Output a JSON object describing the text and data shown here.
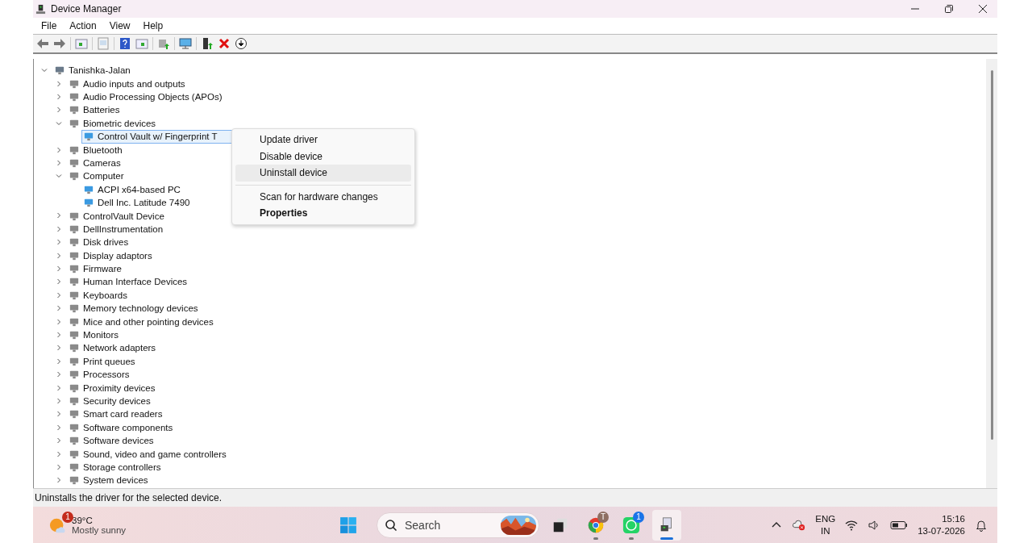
{
  "window": {
    "title": "Device Manager"
  },
  "menu": [
    "File",
    "Action",
    "View",
    "Help"
  ],
  "tree": {
    "label": "Tanishka-Jalan",
    "expanded": true,
    "selected": false,
    "children": [
      {
        "label": "Audio inputs and outputs",
        "expanded": false,
        "selected": false
      },
      {
        "label": "Audio Processing Objects (APOs)",
        "expanded": false,
        "selected": false
      },
      {
        "label": "Batteries",
        "expanded": false,
        "selected": false
      },
      {
        "label": "Biometric devices",
        "expanded": true,
        "selected": false,
        "children": [
          {
            "label": "Control Vault w/ Fingerprint T",
            "selected": true
          }
        ]
      },
      {
        "label": "Bluetooth",
        "expanded": false,
        "selected": false
      },
      {
        "label": "Cameras",
        "expanded": false,
        "selected": false
      },
      {
        "label": "Computer",
        "expanded": true,
        "selected": false,
        "children": [
          {
            "label": "ACPI x64-based PC",
            "selected": false
          },
          {
            "label": "Dell Inc. Latitude 7490",
            "selected": false
          }
        ]
      },
      {
        "label": "ControlVault Device",
        "expanded": false,
        "selected": false
      },
      {
        "label": "DellInstrumentation",
        "expanded": false,
        "selected": false
      },
      {
        "label": "Disk drives",
        "expanded": false,
        "selected": false
      },
      {
        "label": "Display adaptors",
        "expanded": false,
        "selected": false
      },
      {
        "label": "Firmware",
        "expanded": false,
        "selected": false
      },
      {
        "label": "Human Interface Devices",
        "expanded": false,
        "selected": false
      },
      {
        "label": "Keyboards",
        "expanded": false,
        "selected": false
      },
      {
        "label": "Memory technology devices",
        "expanded": false,
        "selected": false
      },
      {
        "label": "Mice and other pointing devices",
        "expanded": false,
        "selected": false
      },
      {
        "label": "Monitors",
        "expanded": false,
        "selected": false
      },
      {
        "label": "Network adapters",
        "expanded": false,
        "selected": false
      },
      {
        "label": "Print queues",
        "expanded": false,
        "selected": false
      },
      {
        "label": "Processors",
        "expanded": false,
        "selected": false
      },
      {
        "label": "Proximity devices",
        "expanded": false,
        "selected": false
      },
      {
        "label": "Security devices",
        "expanded": false,
        "selected": false
      },
      {
        "label": "Smart card readers",
        "expanded": false,
        "selected": false
      },
      {
        "label": "Software components",
        "expanded": false,
        "selected": false
      },
      {
        "label": "Software devices",
        "expanded": false,
        "selected": false
      },
      {
        "label": "Sound, video and game controllers",
        "expanded": false,
        "selected": false
      },
      {
        "label": "Storage controllers",
        "expanded": false,
        "selected": false
      },
      {
        "label": "System devices",
        "expanded": false,
        "selected": false
      }
    ]
  },
  "context_menu": [
    {
      "kind": "item",
      "label": "Update driver",
      "selected": false
    },
    {
      "kind": "item",
      "label": "Disable device",
      "selected": false
    },
    {
      "kind": "item",
      "label": "Uninstall device",
      "selected": true
    },
    {
      "kind": "separator"
    },
    {
      "kind": "default",
      "label": "Scan for hardware changes",
      "selected": false
    },
    {
      "kind": "bold",
      "label": "Properties",
      "selected": false
    }
  ],
  "status_bar": "Uninstalls the driver for the selected device.",
  "taskbar": {
    "weather": {
      "badge": "1",
      "temperature": "39°C",
      "condition": "Mostly sunny"
    },
    "search": {
      "placeholder": "Search"
    },
    "apps": [
      {
        "kind": "taskview",
        "running": false,
        "active": false
      },
      {
        "kind": "browser",
        "badge": "T",
        "running": true,
        "active": false
      },
      {
        "kind": "chat",
        "badge": "1",
        "running": true,
        "active": false
      },
      {
        "kind": "devmgr",
        "running": true,
        "active": true
      }
    ],
    "language": "ENG",
    "region": "IN",
    "time": "15:16",
    "date": "13-07-2026"
  }
}
